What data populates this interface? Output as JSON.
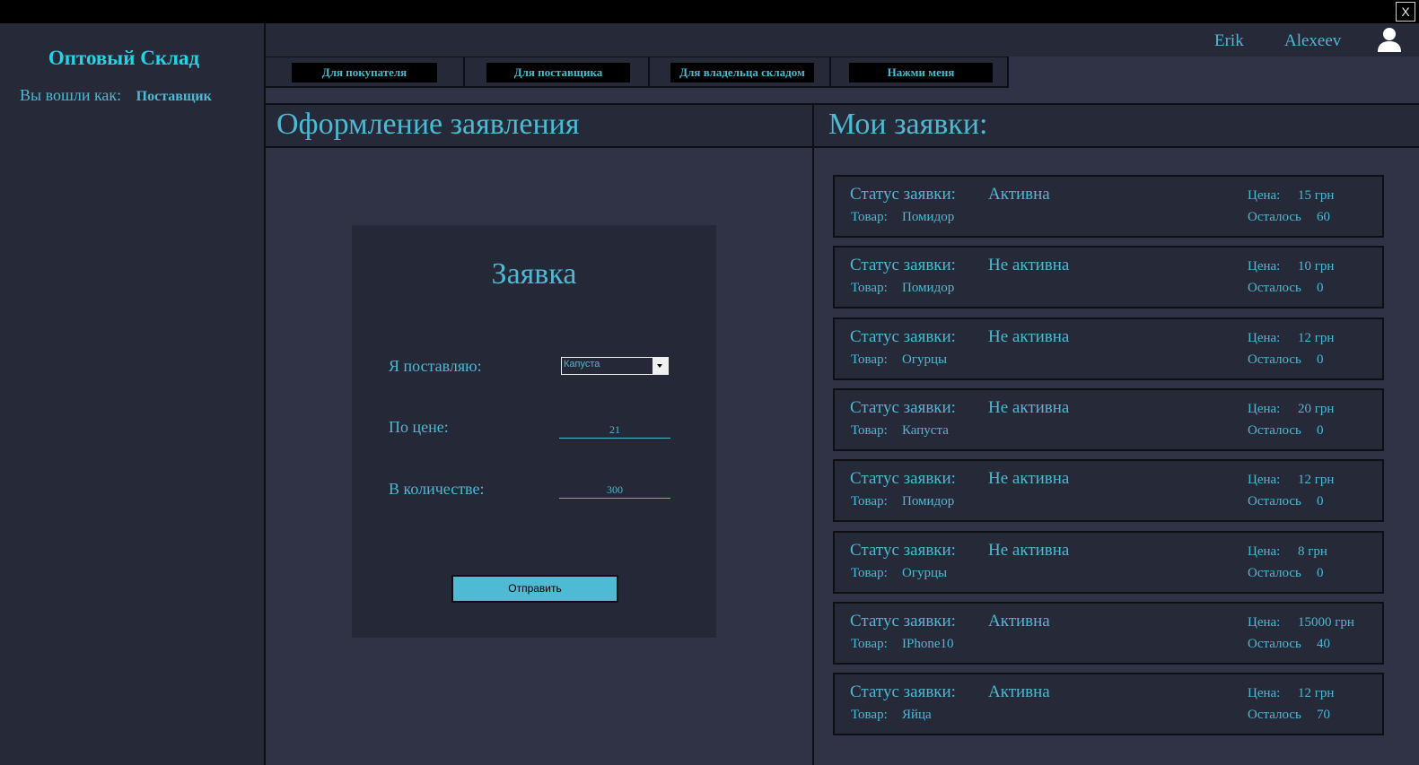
{
  "window": {
    "close_label": "X"
  },
  "sidebar": {
    "app_title": "Оптовый Склад",
    "login_label": "Вы вошли как:",
    "login_role": "Поставщик"
  },
  "user": {
    "first_name": "Erik",
    "last_name": "Alexeev",
    "avatar_icon": "user-icon"
  },
  "tabs": [
    {
      "label": "Для покупателя"
    },
    {
      "label": "Для поставщика"
    },
    {
      "label": "Для владельца складом"
    },
    {
      "label": "Нажми меня"
    }
  ],
  "form_panel": {
    "heading": "Оформление заявления",
    "card_title": "Заявка",
    "supply_label": "Я поставляю:",
    "supply_value": "Капуста",
    "price_label": "По цене:",
    "price_value": "21",
    "qty_label": "В количестве:",
    "qty_value": "300",
    "submit_label": "Отправить"
  },
  "orders_panel": {
    "heading": "Мои заявки:",
    "status_label": "Статус заявки:",
    "good_label": "Товар:",
    "price_label": "Цена:",
    "left_label": "Осталось",
    "items": [
      {
        "status": "Активна",
        "good": "Помидор",
        "price": "15 грн",
        "left": "60"
      },
      {
        "status": "Не активна",
        "good": "Помидор",
        "price": "10 грн",
        "left": "0"
      },
      {
        "status": "Не активна",
        "good": "Огурцы",
        "price": "12 грн",
        "left": "0"
      },
      {
        "status": "Не активна",
        "good": "Капуста",
        "price": "20 грн",
        "left": "0"
      },
      {
        "status": "Не активна",
        "good": "Помидор",
        "price": "12 грн",
        "left": "0"
      },
      {
        "status": "Не активна",
        "good": "Огурцы",
        "price": "8 грн",
        "left": "0"
      },
      {
        "status": "Активна",
        "good": "IPhone10",
        "price": "15000 грн",
        "left": "40"
      },
      {
        "status": "Активна",
        "good": "Яйца",
        "price": "12 грн",
        "left": "70"
      }
    ]
  },
  "colors": {
    "accent": "#4fb8d2",
    "title": "#21d4e6",
    "panel": "#262938",
    "background": "#303346",
    "button": "#4fbad3"
  }
}
